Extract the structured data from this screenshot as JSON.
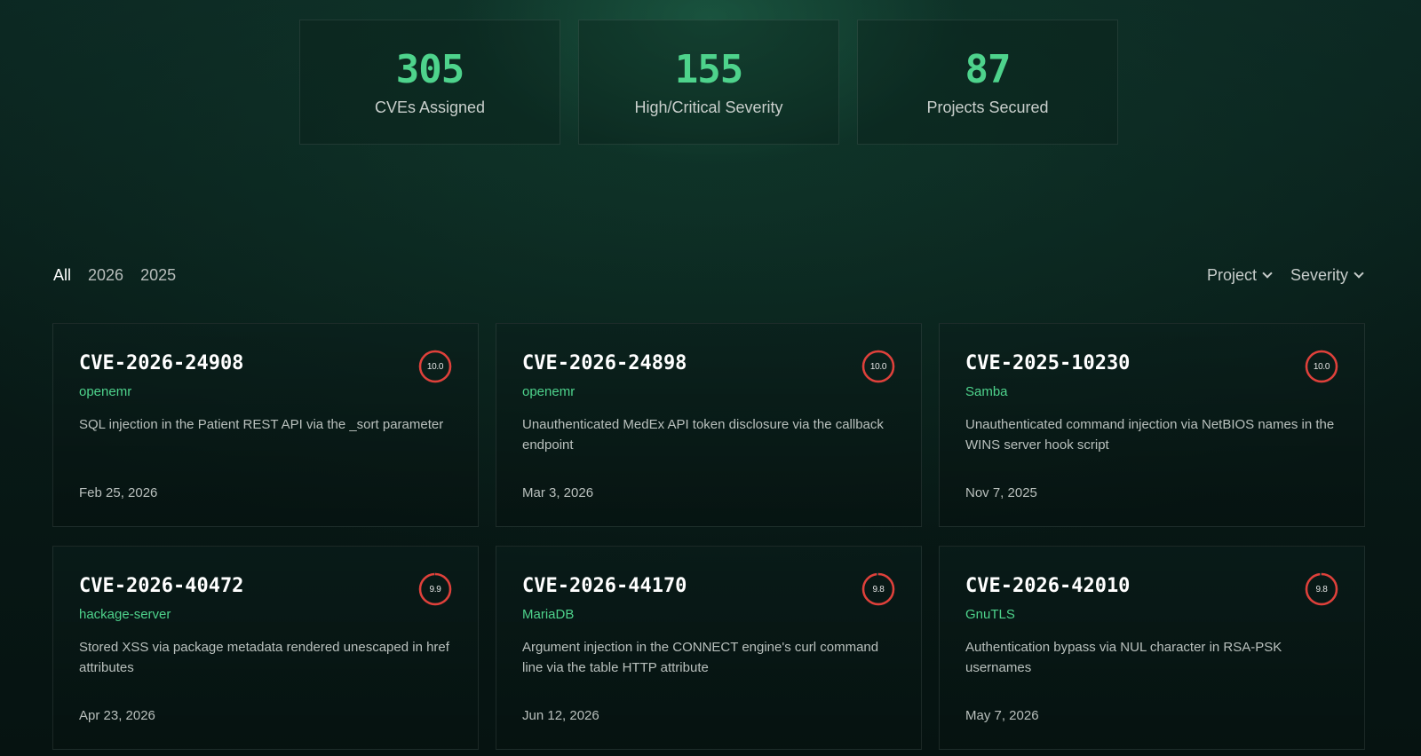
{
  "stats": [
    {
      "value": "305",
      "label": "CVEs Assigned"
    },
    {
      "value": "155",
      "label": "High/Critical Severity"
    },
    {
      "value": "87",
      "label": "Projects Secured"
    }
  ],
  "filters": {
    "years": [
      "All",
      "2026",
      "2025"
    ],
    "active_year": "All",
    "project_label": "Project",
    "severity_label": "Severity"
  },
  "colors": {
    "accent": "#4ed38c",
    "critical_ring": "#e0403a"
  },
  "cards": [
    {
      "id": "CVE-2026-24908",
      "project": "openemr",
      "score": "10.0",
      "desc": "SQL injection in the Patient REST API via the _sort parameter",
      "date": "Feb 25, 2026"
    },
    {
      "id": "CVE-2026-24898",
      "project": "openemr",
      "score": "10.0",
      "desc": "Unauthenticated MedEx API token disclosure via the callback endpoint",
      "date": "Mar 3, 2026"
    },
    {
      "id": "CVE-2025-10230",
      "project": "Samba",
      "score": "10.0",
      "desc": "Unauthenticated command injection via NetBIOS names in the WINS server hook script",
      "date": "Nov 7, 2025"
    },
    {
      "id": "CVE-2026-40472",
      "project": "hackage-server",
      "score": "9.9",
      "desc": "Stored XSS via package metadata rendered unescaped in href attributes",
      "date": "Apr 23, 2026"
    },
    {
      "id": "CVE-2026-44170",
      "project": "MariaDB",
      "score": "9.8",
      "desc": "Argument injection in the CONNECT engine's curl command line via the table HTTP attribute",
      "date": "Jun 12, 2026"
    },
    {
      "id": "CVE-2026-42010",
      "project": "GnuTLS",
      "score": "9.8",
      "desc": "Authentication bypass via NUL character in RSA-PSK usernames",
      "date": "May 7, 2026"
    }
  ]
}
